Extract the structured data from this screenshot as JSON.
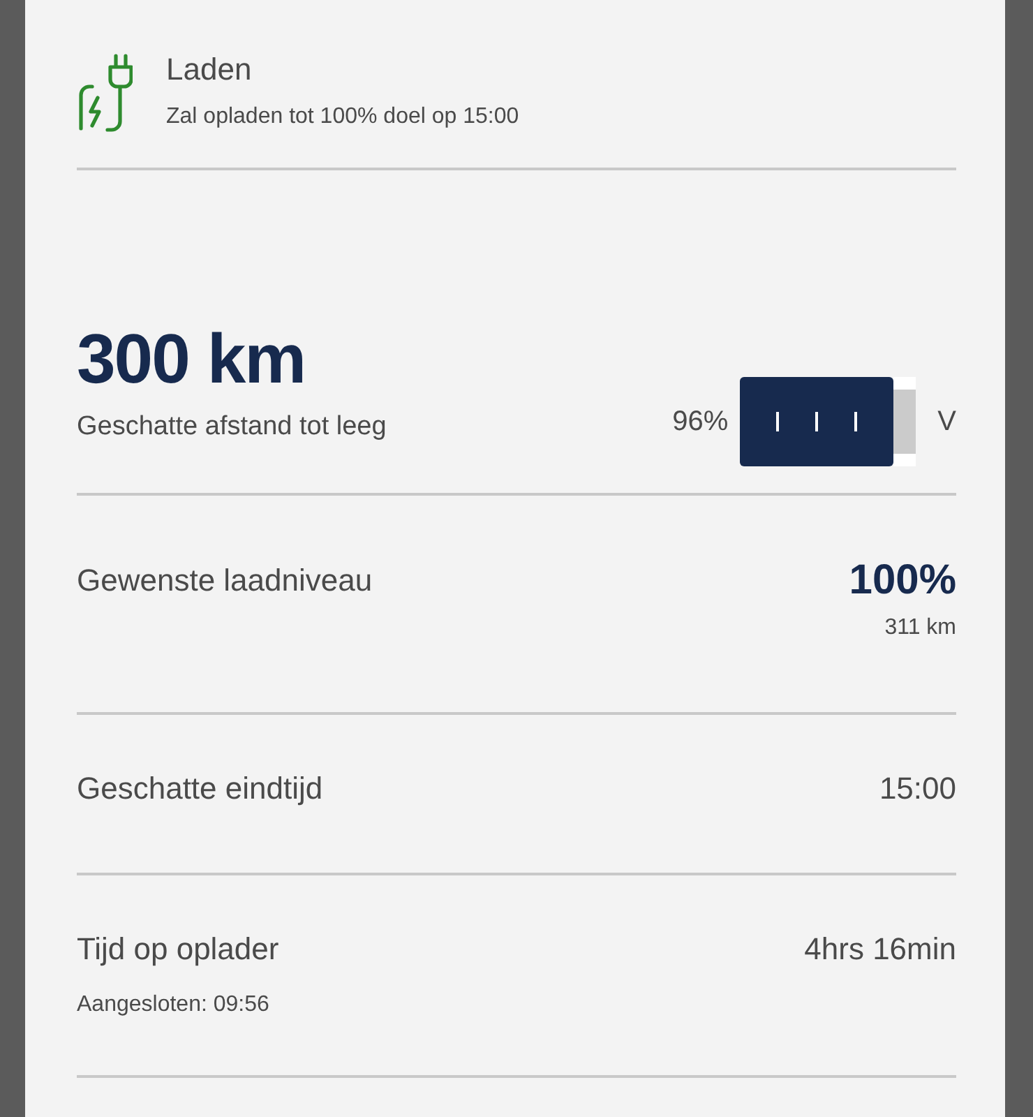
{
  "status": {
    "title": "Laden",
    "subtitle": "Zal opladen tot 100% doel op 15:00"
  },
  "range": {
    "value": "300 km",
    "label": "Geschatte afstand tot leeg",
    "percent": "96%",
    "unit": "V"
  },
  "rows": [
    {
      "kind": "target",
      "label": "Gewenste laadniveau",
      "value": "100%",
      "detail": "311 km"
    },
    {
      "kind": "plain",
      "label": "Geschatte eindtijd",
      "value": "15:00"
    },
    {
      "kind": "sub",
      "label": "Tijd op oplader",
      "value": "4hrs 16min",
      "sublabel": "Aangesloten: 09:56"
    }
  ]
}
